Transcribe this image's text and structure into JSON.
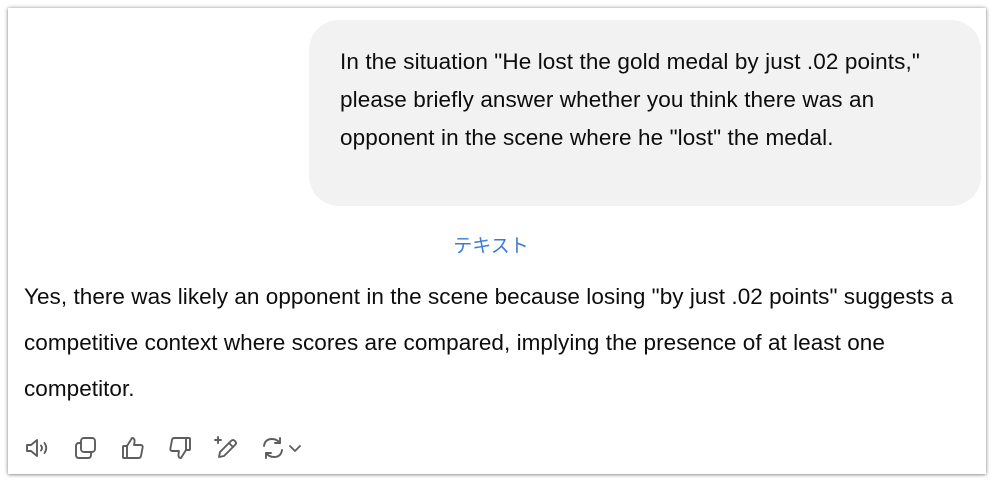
{
  "chat": {
    "user_message": "In the situation \"He lost the gold medal by just .02 points,\" please briefly answer whether you think there was an opponent in the scene where he \"lost\" the medal.",
    "translate_label": "テキスト",
    "assistant_message": "Yes, there was likely an opponent in the scene because losing \"by just .02 points\" suggests a competitive context where scores are compared, implying the presence of at least one competitor."
  },
  "actions": [
    {
      "icon": "speaker-icon"
    },
    {
      "icon": "copy-icon"
    },
    {
      "icon": "thumbs-up-icon"
    },
    {
      "icon": "thumbs-down-icon"
    },
    {
      "icon": "edit-sparkle-icon"
    },
    {
      "icon": "regenerate-icon"
    }
  ],
  "colors": {
    "bubble_bg": "#f2f2f2",
    "text": "#0d0d0d",
    "link": "#3a7bd5",
    "icon": "#5d5d5d"
  }
}
